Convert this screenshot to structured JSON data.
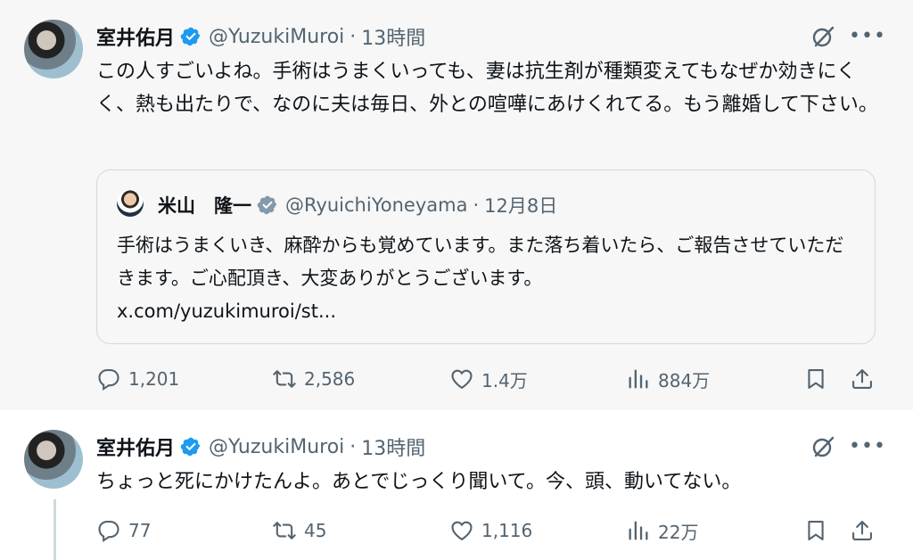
{
  "tweets": [
    {
      "author": {
        "name": "室井佑月",
        "handle": "@YuzukiMuroi",
        "separator": "·",
        "time": "13時間"
      },
      "text": "この人すごいよね。手術はうまくいっても、妻は抗生剤が種類変えてもなぜか効きにくく、熱も出たりで、なのに夫は毎日、外との喧嘩にあけくれてる。もう離婚して下さい。",
      "quote": {
        "author": {
          "name": "米山　隆一",
          "handle": "@RyuichiYoneyama",
          "separator": "·",
          "time": "12月8日"
        },
        "text": "手術はうまくいき、麻酔からも覚めています。また落ち着いたら、ご報告させていただきます。ご心配頂き、大変ありがとうございます。",
        "link": "x.com/yuzukimuroi/st..."
      },
      "stats": {
        "replies": "1,201",
        "reposts": "2,586",
        "likes": "1.4万",
        "views": "884万"
      }
    },
    {
      "author": {
        "name": "室井佑月",
        "handle": "@YuzukiMuroi",
        "separator": "·",
        "time": "13時間"
      },
      "text": "ちょっと死にかけたんよ。あとでじっくり聞いて。今、頭、動いてない。",
      "stats": {
        "replies": "77",
        "reposts": "45",
        "likes": "1,116",
        "views": "22万"
      }
    }
  ],
  "icons": {
    "verified": "verified-badge-icon",
    "grok": "grok-icon",
    "more": "more-icon",
    "reply": "reply-icon",
    "repost": "repost-icon",
    "like": "like-icon",
    "views": "views-icon",
    "bookmark": "bookmark-icon",
    "share": "share-icon"
  },
  "colors": {
    "verified": "#1d9bf0",
    "muted": "#536471",
    "text": "#0f1419",
    "highlight_bg": "#f7f7f7"
  }
}
